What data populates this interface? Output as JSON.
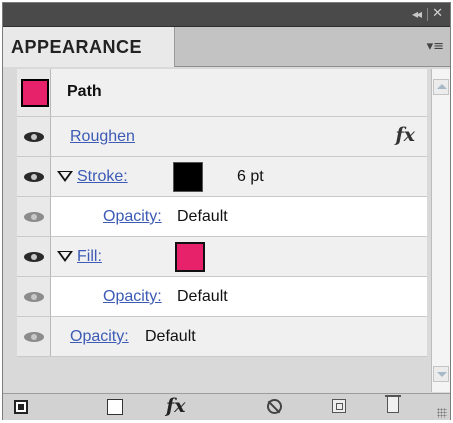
{
  "panel": {
    "tab_label": "APPEARANCE",
    "title_controls": {
      "collapse": "◂◂",
      "close": "✕"
    },
    "menu_icon": "panel-menu-icon"
  },
  "path_row": {
    "label": "Path",
    "swatch_color": "#e8226a"
  },
  "rows": {
    "roughen": {
      "label": "Roughen",
      "fx": "fx"
    },
    "stroke": {
      "label": "Stroke:",
      "color": "#000000",
      "weight": "6 pt"
    },
    "stroke_opacity": {
      "label": "Opacity:",
      "value": "Default"
    },
    "fill": {
      "label": "Fill:",
      "color": "#e8226a"
    },
    "fill_opacity": {
      "label": "Opacity:",
      "value": "Default"
    },
    "object_opacity": {
      "label": "Opacity:",
      "value": "Default"
    }
  },
  "bottom_toolbar": {
    "icons": [
      "new-art-maintains-appearance-icon",
      "clear-appearance-icon",
      "add-new-effect-icon",
      "delete-effect-icon",
      "duplicate-item-icon",
      "delete-item-icon"
    ],
    "fx_label": "fx"
  }
}
